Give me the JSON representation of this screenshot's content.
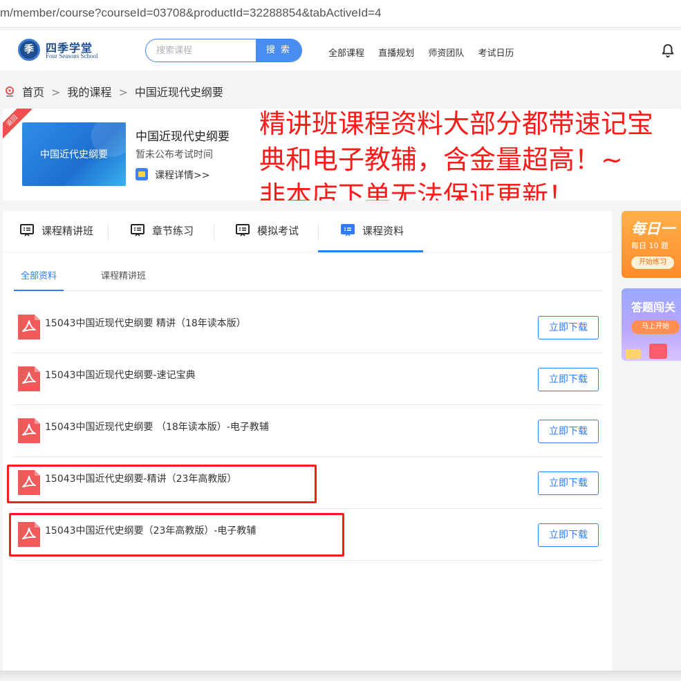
{
  "browser": {
    "url": "m/member/course?courseId=03708&productId=32288854&tabActiveId=4"
  },
  "header": {
    "logo_cn": "四季学堂",
    "logo_en": "Four Seasons School",
    "logo_mark": "季",
    "search_placeholder": "搜索课程",
    "search_button": "搜 索",
    "nav": [
      "全部课程",
      "直播规划",
      "师资团队",
      "考试日历"
    ]
  },
  "breadcrumb": {
    "home": "首页",
    "sep": ">",
    "mine": "我的课程",
    "current": "中国近现代史纲要"
  },
  "course": {
    "ribbon": "返回",
    "thumb_text": "中国近代史纲要",
    "title": "中国近现代史纲要",
    "exam_time": "暂未公布考试时间",
    "detail_link": "课程详情>>"
  },
  "overlay": {
    "line1": "精讲班课程资料大部分都带速记宝",
    "line2": "典和电子教辅，含金量超高！~",
    "line3": "非本店下单无法保证更新！"
  },
  "tabs": [
    {
      "label": "课程精讲班"
    },
    {
      "label": "章节练习"
    },
    {
      "label": "模拟考试"
    },
    {
      "label": "课程资料"
    }
  ],
  "subtabs": [
    {
      "label": "全部资料"
    },
    {
      "label": "课程精讲班"
    }
  ],
  "materials": [
    {
      "name": "15043中国近现代史纲要 精讲（18年读本版）",
      "action": "立即下载"
    },
    {
      "name": "15043中国近现代史纲要-速记宝典",
      "action": "立即下载"
    },
    {
      "name": "15043中国近现代史纲要 （18年读本版）-电子教辅",
      "action": "立即下载"
    },
    {
      "name": "15043中国近代史纲要-精讲（23年高教版）",
      "action": "立即下载"
    },
    {
      "name": "15043中国近代史纲要（23年高教版）-电子教辅",
      "action": "立即下载"
    }
  ],
  "side": {
    "daily_title": "每日一",
    "daily_sub": "每日 10 题",
    "daily_btn": "开始练习",
    "quiz_title": "答题闯关",
    "quiz_btn": "马上开始"
  },
  "colors": {
    "accent": "#2f7cf6",
    "overlay_red": "#ff1a1a",
    "pdf_red": "#f15a5a"
  }
}
